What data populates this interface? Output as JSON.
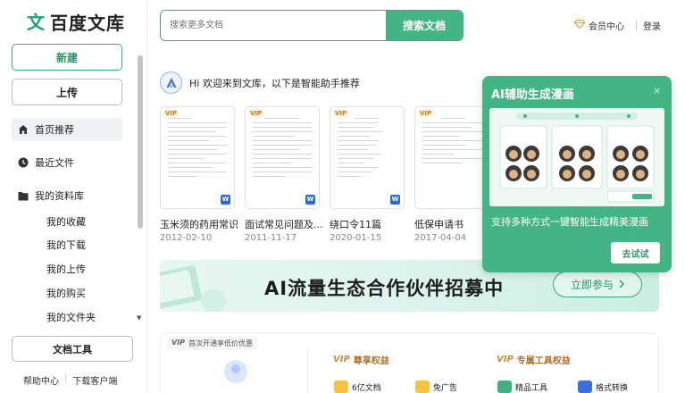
{
  "brand": {
    "logo_mark": "文",
    "name": "百度文库"
  },
  "sidebar": {
    "new_label": "新建",
    "upload_label": "上传",
    "nav": [
      {
        "label": "首页推荐",
        "icon": "home-icon",
        "active": true
      },
      {
        "label": "最近文件",
        "icon": "clock-icon"
      },
      {
        "label": "我的资料库",
        "icon": "folder-icon"
      }
    ],
    "sub_items": [
      "我的收藏",
      "我的下载",
      "我的上传",
      "我的购买",
      "我的文件夹"
    ],
    "tools_label": "文档工具",
    "footer": {
      "help": "帮助中心",
      "divider": "|",
      "download": "下载客户端"
    }
  },
  "header": {
    "search_placeholder": "搜索更多文档",
    "search_button": "搜索文档",
    "member_center": "会员中心",
    "login": "登录"
  },
  "greeting": "Hi 欢迎来到文库，以下是智能助手推荐",
  "docs": [
    {
      "title": "玉米须的药用常识",
      "date": "2012-02-10",
      "vip": true
    },
    {
      "title": "面试常见问题及...",
      "date": "2011-11-17",
      "vip": true
    },
    {
      "title": "绕口令11篇",
      "date": "2020-01-15",
      "vip": true
    },
    {
      "title": "低保申请书",
      "date": "2017-04-04",
      "vip": true
    }
  ],
  "vip_badge": "VIP",
  "word_badge": "W",
  "banner": {
    "text": "AI流量生态合作伙伴招募中",
    "button": "立即参与"
  },
  "vip_section": {
    "tag_prefix": "VIP",
    "tag_text": "首次开通享低价优惠",
    "exclusive": "尊享权益",
    "tools": "专属工具权益",
    "perks": [
      "6亿文档",
      "免广告",
      "精品工具",
      "格式转换"
    ]
  },
  "popup": {
    "title": "AI辅助生成漫画",
    "desc": "支持多种方式一键智能生成精美漫画",
    "button": "去试试",
    "close": "×"
  },
  "colors": {
    "brand_green": "#43b585",
    "vip_gold": "#c77a1e",
    "word_blue": "#2b6ad1"
  }
}
